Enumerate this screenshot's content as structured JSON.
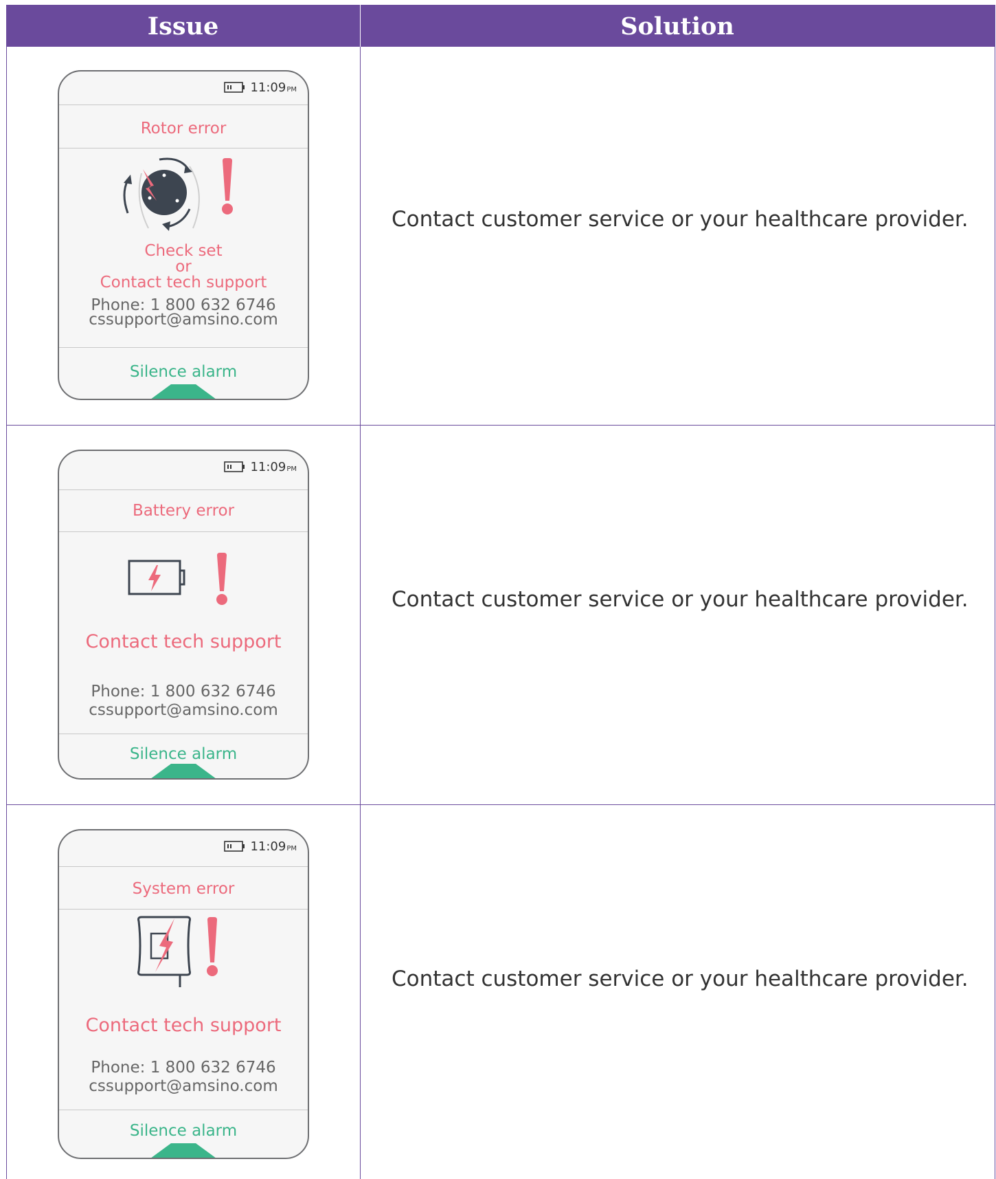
{
  "header": {
    "issue_label": "Issue",
    "solution_label": "Solution"
  },
  "rows": [
    {
      "time": "11:09",
      "meridiem": "PM",
      "error_title": "Rotor error",
      "message_line1": "Check set",
      "message_line2": "or",
      "message_line3": "Contact tech support",
      "phone": "Phone: 1 800 632 6746",
      "email": "cssupport@amsino.com",
      "silence_label": "Silence alarm",
      "icon": "rotor-error-icon",
      "solution": "Contact customer service or your healthcare provider."
    },
    {
      "time": "11:09",
      "meridiem": "PM",
      "error_title": "Battery error",
      "message": "Contact tech support",
      "phone": "Phone: 1 800 632 6746",
      "email": "cssupport@amsino.com",
      "silence_label": "Silence alarm",
      "icon": "battery-error-icon",
      "solution": "Contact customer service or your healthcare provider."
    },
    {
      "time": "11:09",
      "meridiem": "PM",
      "error_title": "System error",
      "message": "Contact tech support",
      "phone": "Phone: 1 800 632 6746",
      "email": "cssupport@amsino.com",
      "silence_label": "Silence alarm",
      "icon": "system-error-icon",
      "solution": "Contact customer service or your healthcare provider."
    }
  ],
  "colors": {
    "header_bg": "#6a4a9c",
    "alert": "#ec6a7c",
    "silence": "#3bb58a",
    "dark_icon": "#3d4550"
  }
}
